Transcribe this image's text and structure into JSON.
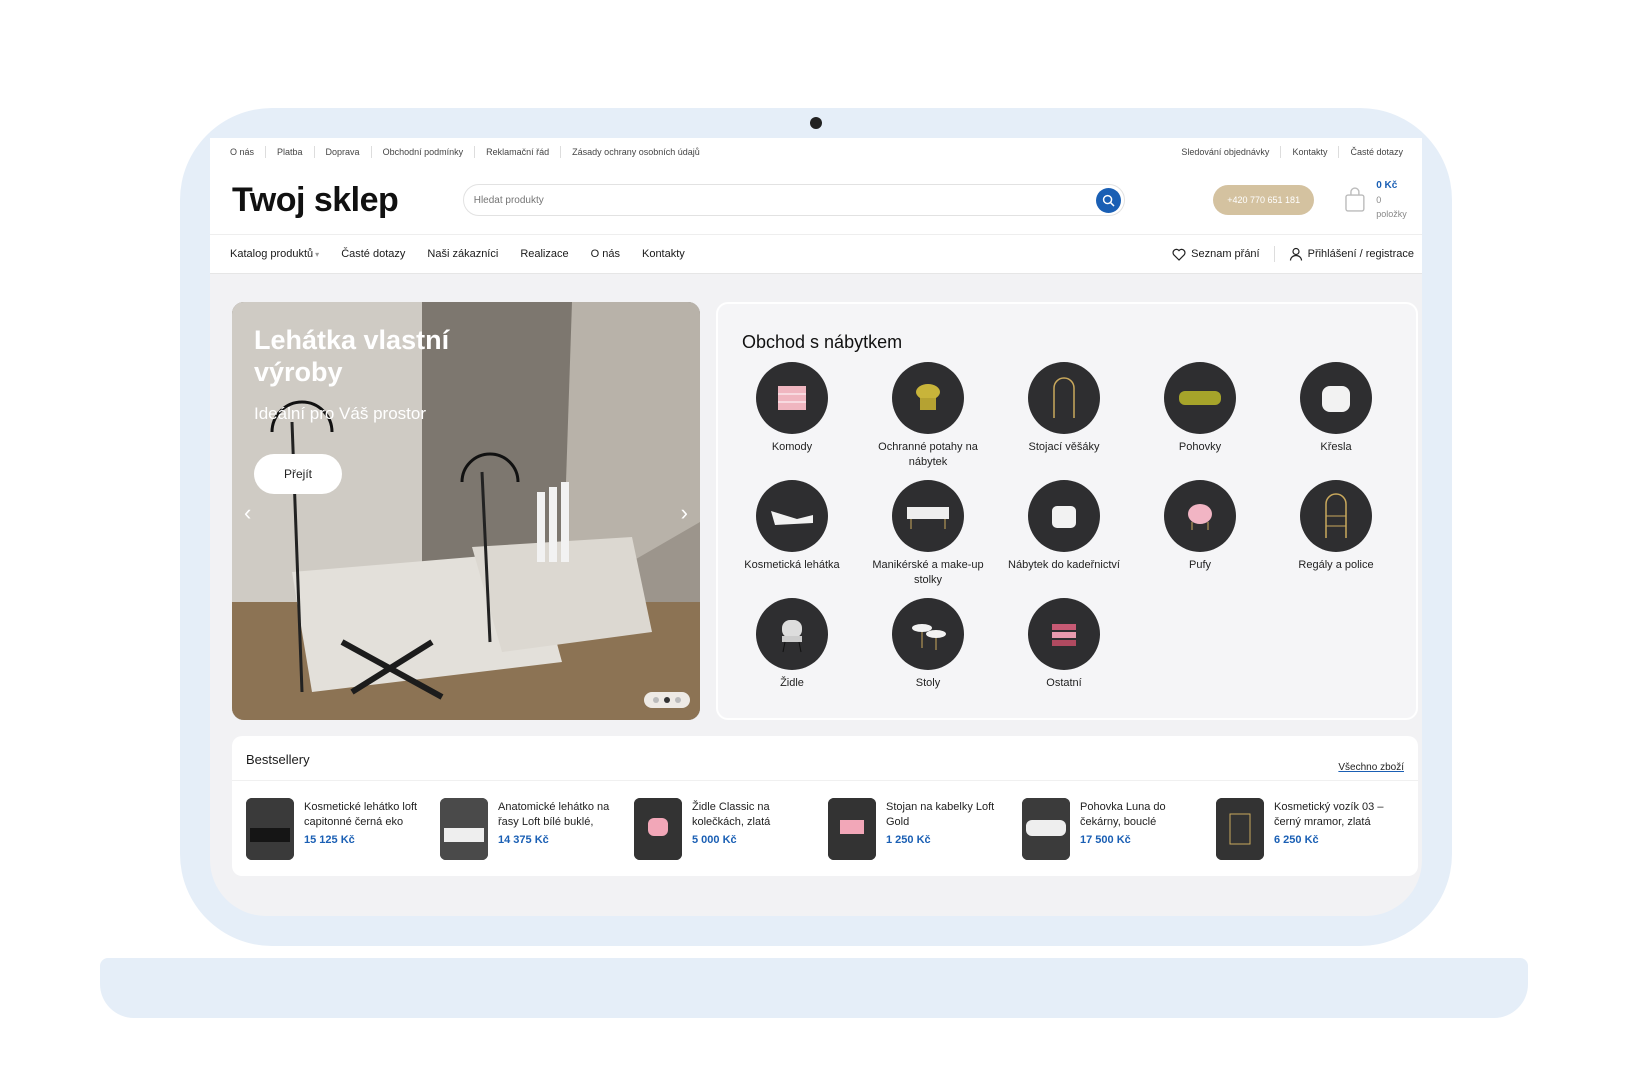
{
  "topbar": {
    "left_links": [
      "O nás",
      "Platba",
      "Doprava",
      "Obchodní podmínky",
      "Reklamační řád",
      "Zásady ochrany osobních údajů"
    ],
    "right_links": [
      "Sledování objednávky",
      "Kontakty",
      "Časté dotazy"
    ]
  },
  "header": {
    "logo": "Twoj sklep",
    "search_placeholder": "Hledat produkty",
    "phone": "+420 770 651 181",
    "cart_price": "0 Kč",
    "cart_items": "0 položky"
  },
  "nav": {
    "items": [
      "Katalog produktů",
      "Časté dotazy",
      "Naši zákazníci",
      "Realizace",
      "O nás",
      "Kontakty"
    ],
    "wishlist": "Seznam přání",
    "login": "Přihlášení / registrace"
  },
  "hero": {
    "title": "Lehátka vlastní výroby",
    "subtitle": "Ideální pro Váš prostor",
    "button": "Přejít",
    "slides_total": 3,
    "active_slide": 2
  },
  "categories": {
    "title": "Obchod s nábytkem",
    "items": [
      "Komody",
      "Ochranné potahy na nábytek",
      "Stojací věšáky",
      "Pohovky",
      "Křesla",
      "Kosmetická lehátka",
      "Manikérské a make-up stolky",
      "Nábytek do kadeřnictví",
      "Pufy",
      "Regály a police",
      "Židle",
      "Stoly",
      "Ostatní"
    ]
  },
  "bestsellers": {
    "title": "Bestsellery",
    "all_link": "Všechno zboží",
    "products": [
      {
        "name": "Kosmetické lehátko loft capitonné černá eko",
        "price": "15 125 Kč"
      },
      {
        "name": "Anatomické lehátko na řasy Loft bílé buklé,",
        "price": "14 375 Kč"
      },
      {
        "name": "Židle Classic na kolečkách, zlatá",
        "price": "5 000 Kč"
      },
      {
        "name": "Stojan na kabelky Loft Gold",
        "price": "1 250 Kč"
      },
      {
        "name": "Pohovka Luna do čekárny, bouclé",
        "price": "17 500 Kč"
      },
      {
        "name": "Kosmetický vozík 03 – černý mramor, zlatá",
        "price": "6 250 Kč"
      }
    ]
  },
  "colors": {
    "accent": "#1a5fb4",
    "phone_button": "#d4c2a0",
    "frame": "#e5eef8"
  }
}
